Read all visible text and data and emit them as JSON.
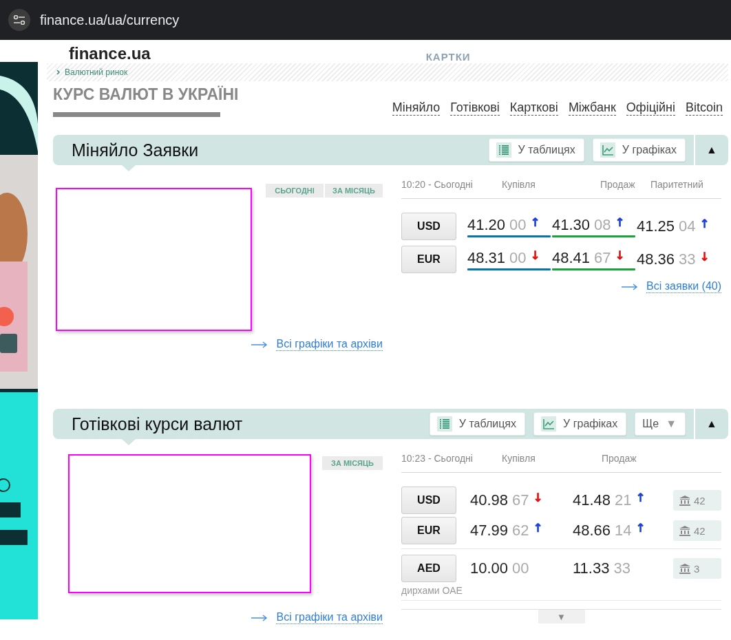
{
  "browser": {
    "url": "finance.ua/ua/currency"
  },
  "header": {
    "logo": "finance.ua",
    "nav_item": "КАРТКИ"
  },
  "breadcrumb": "Валютний ринок",
  "page_title": "КУРС ВАЛЮТ В УКРАЇНІ",
  "nav_links": [
    "Міняйло",
    "Готівкові",
    "Карткові",
    "Міжбанк",
    "Офіційні",
    "Bitcoin"
  ],
  "sections": [
    {
      "kind": "exchange",
      "title": "Міняйло Заявки",
      "buttons": [
        {
          "kind": "table",
          "label": "У таблицях"
        },
        {
          "kind": "chart",
          "label": "У графіках"
        }
      ],
      "collapse": "▲",
      "period_tabs": [
        "СЬОГОДНІ",
        "ЗА МІСЯЦЬ"
      ],
      "charts_link": "Всі графіки та архіви",
      "time_label": "10:20 - Сьогодні",
      "columns": [
        "Купівля",
        "Продаж",
        "Паритетний"
      ],
      "rows": [
        {
          "code": "USD",
          "cells": [
            {
              "main": "41.20",
              "minor": "00",
              "arrow": "↑",
              "color": "#1a3fd6"
            },
            {
              "main": "41.30",
              "minor": "08",
              "arrow": "↑",
              "color": "#1a3fd6"
            },
            {
              "main": "41.25",
              "minor": "04",
              "arrow": "↑",
              "color": "#1a3fd6"
            }
          ]
        },
        {
          "code": "EUR",
          "cells": [
            {
              "main": "48.31",
              "minor": "00",
              "arrow": "↓",
              "color": "#e01010"
            },
            {
              "main": "48.41",
              "minor": "67",
              "arrow": "↓",
              "color": "#e01010"
            },
            {
              "main": "48.36",
              "minor": "33",
              "arrow": "↓",
              "color": "#e01010"
            }
          ]
        }
      ],
      "all_link": "Всі заявки (40)"
    },
    {
      "kind": "cash",
      "title": "Готівкові курси валют",
      "buttons": [
        {
          "kind": "table",
          "label": "У таблицях"
        },
        {
          "kind": "chart",
          "label": "У графіках"
        },
        {
          "kind": "more",
          "label": "Ще",
          "caret": "▼"
        }
      ],
      "collapse": "▲",
      "period_tabs": [
        "ЗА МІСЯЦЬ"
      ],
      "charts_link": "Всі графіки та архіви",
      "time_label": "10:23 - Сьогодні",
      "columns": [
        "Купівля",
        "Продаж"
      ],
      "rows": [
        {
          "code": "USD",
          "cells": [
            {
              "main": "40.98",
              "minor": "67",
              "arrow": "↓",
              "color": "#e01010"
            },
            {
              "main": "41.48",
              "minor": "21",
              "arrow": "↑",
              "color": "#1a3fd6"
            }
          ],
          "banks": "42"
        },
        {
          "code": "EUR",
          "cells": [
            {
              "main": "47.99",
              "minor": "62",
              "arrow": "↑",
              "color": "#1a3fd6"
            },
            {
              "main": "48.66",
              "minor": "14",
              "arrow": "↑",
              "color": "#1a3fd6"
            }
          ],
          "banks": "42"
        },
        {
          "code": "AED",
          "name": "дирхами ОАЕ",
          "cells": [
            {
              "main": "10.00",
              "minor": "00"
            },
            {
              "main": "11.33",
              "minor": "33"
            }
          ],
          "banks": "3"
        }
      ],
      "more_caret": "▼"
    }
  ]
}
